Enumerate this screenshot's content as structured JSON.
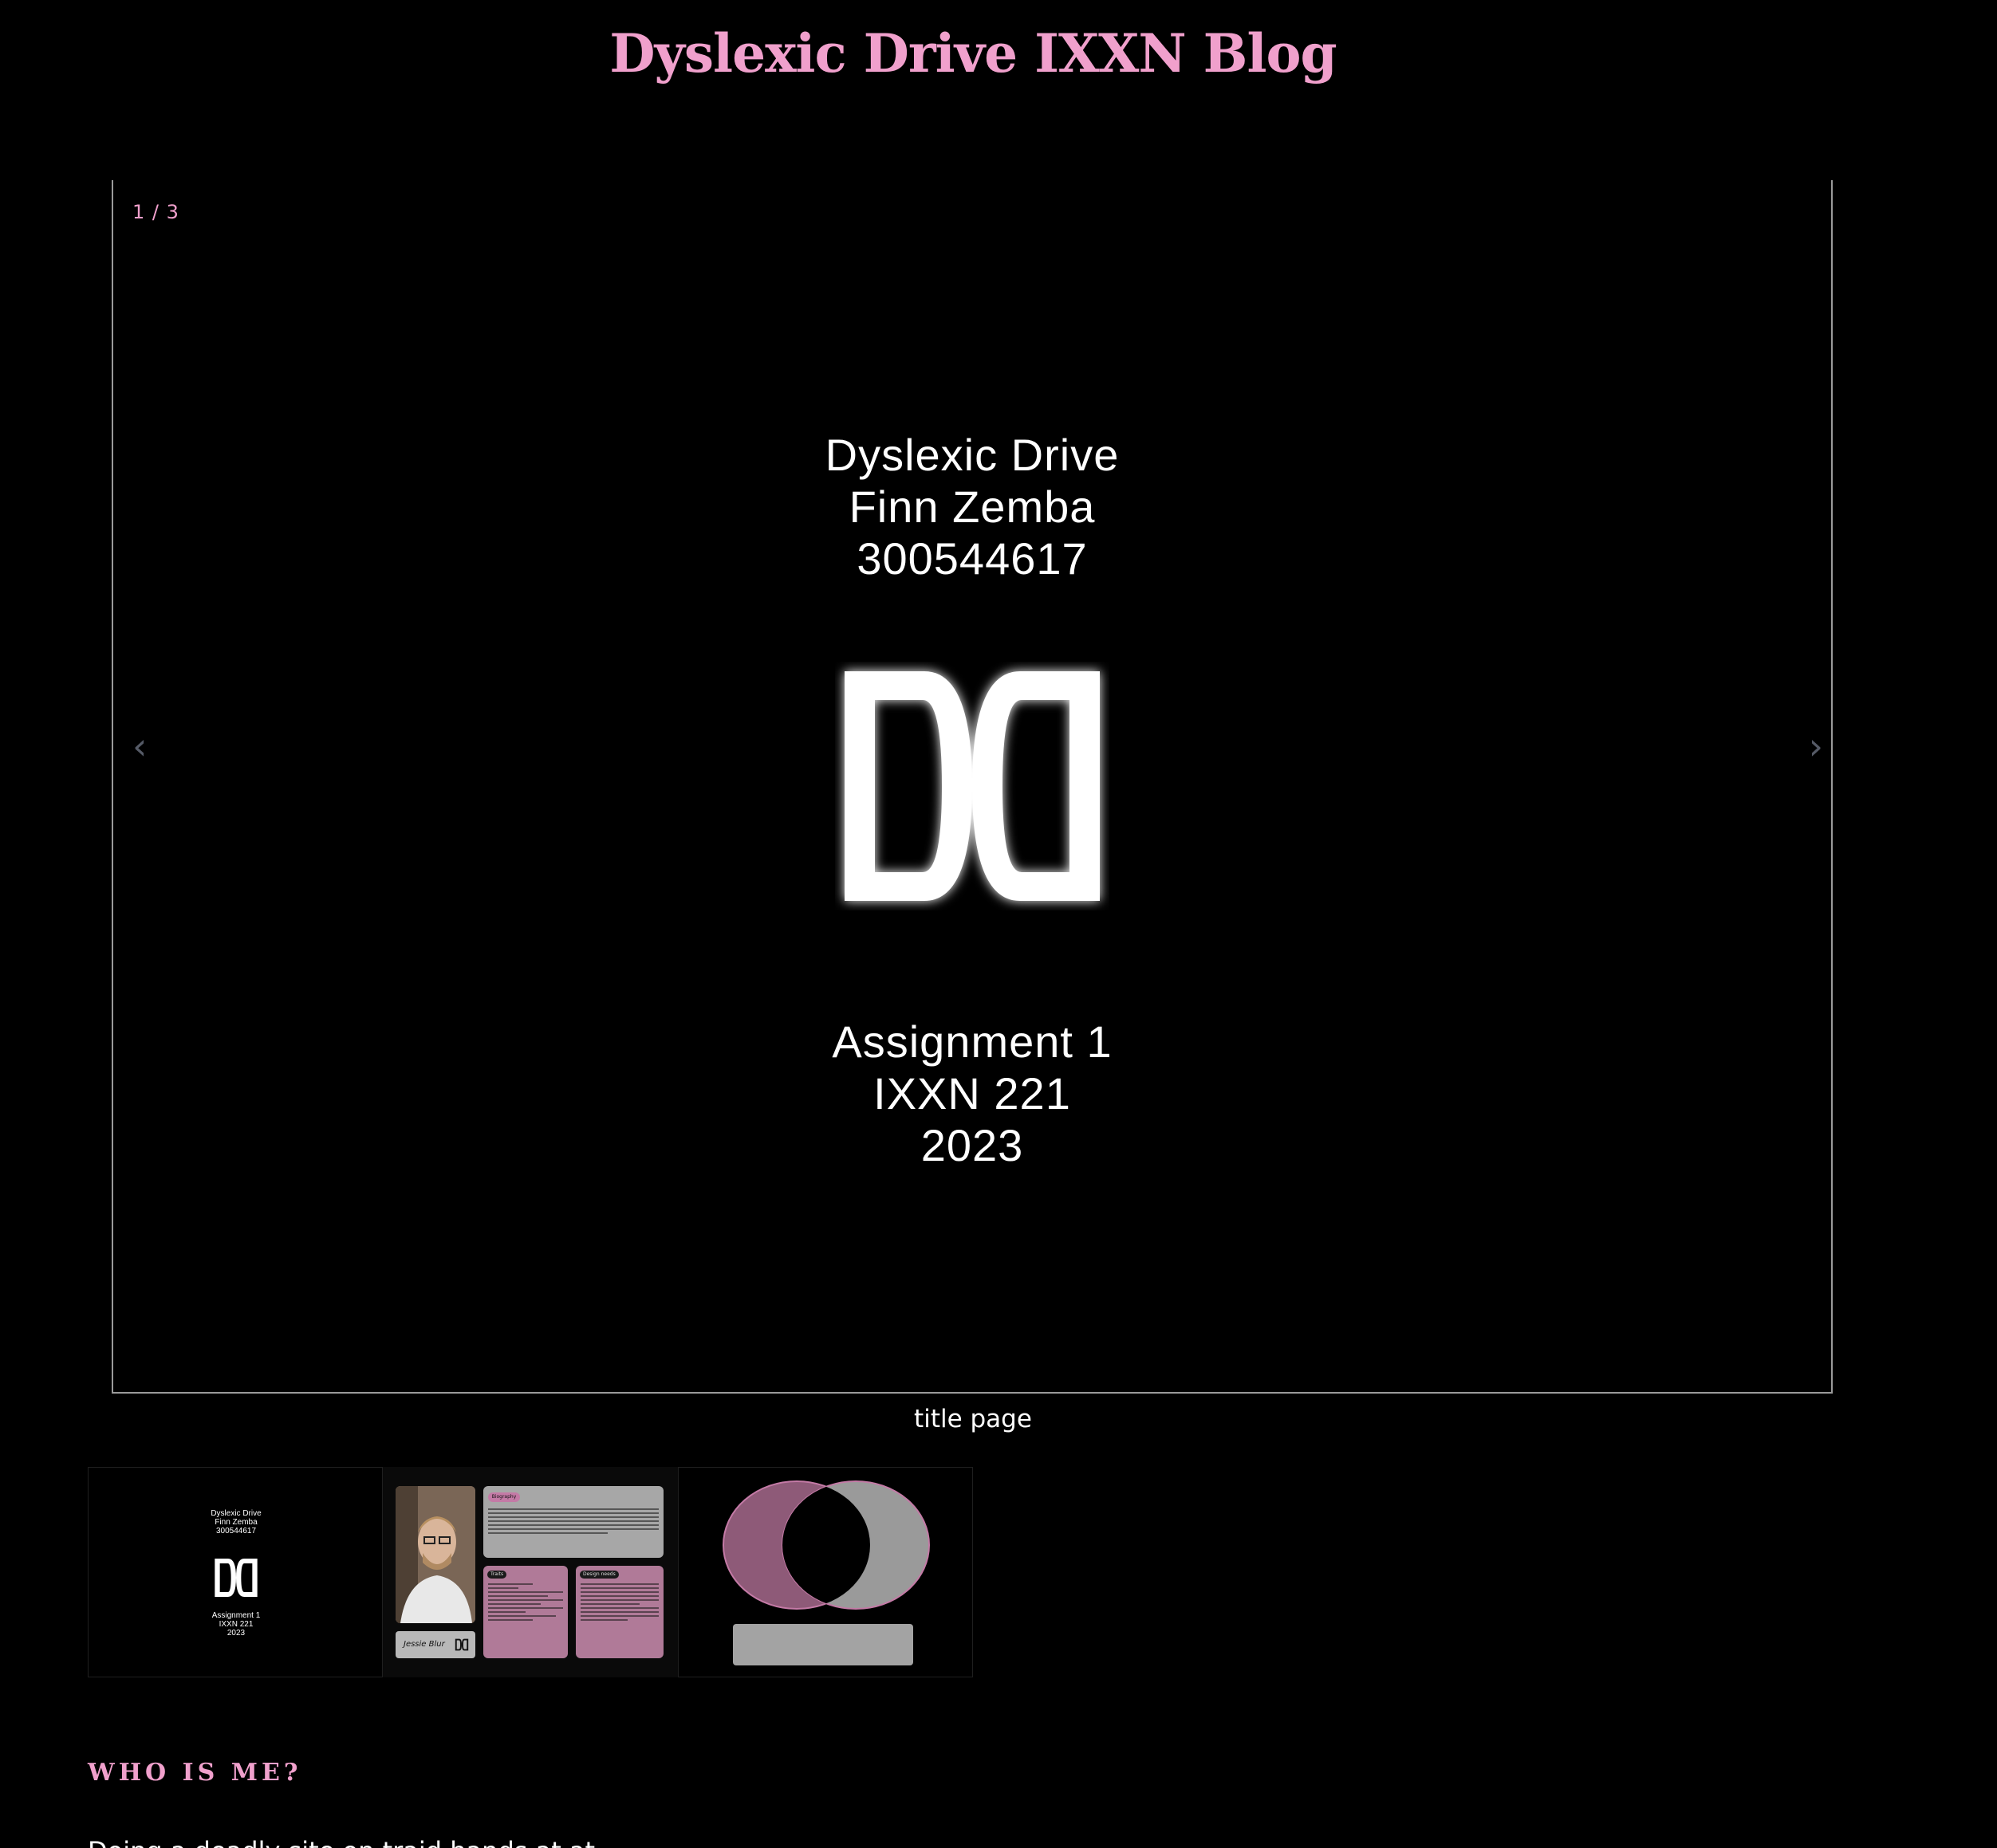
{
  "site": {
    "title": "Dyslexic Drive IXXN Blog"
  },
  "slideshow": {
    "counter": "1 / 3",
    "prev_icon": "chevron-left-icon",
    "next_icon": "chevron-right-icon",
    "prev_glyph": "‹",
    "next_glyph": "›",
    "slide": {
      "top_lines": [
        "Dyslexic Drive",
        "Finn Zemba",
        "300544617"
      ],
      "bottom_lines": [
        "Assignment 1",
        "IXXN 221",
        "2023"
      ],
      "logo": "dyslexic-drive-logo"
    },
    "caption": "title page"
  },
  "thumbnails": [
    {
      "name": "title page",
      "top_lines": [
        "Dyslexic Drive",
        "Finn Zemba",
        "300544617"
      ],
      "bottom_lines": [
        "Assignment 1",
        "IXXN 221",
        "2023"
      ]
    },
    {
      "name": "persona",
      "persona_name": "Jessie Blur",
      "bio_tag": "Biography",
      "card_a_tag": "Traits",
      "card_b_tag": "Design needs"
    },
    {
      "name": "venn diagram"
    }
  ],
  "section": {
    "heading": "WHO IS ME?",
    "paragraph": "Doing a deadly site on traid hands at at"
  },
  "colors": {
    "accent": "#f0a0cc",
    "background": "#000000",
    "text": "#ffffff",
    "venn_pink": "#8e5a78",
    "venn_gray": "#9a9a9a"
  }
}
